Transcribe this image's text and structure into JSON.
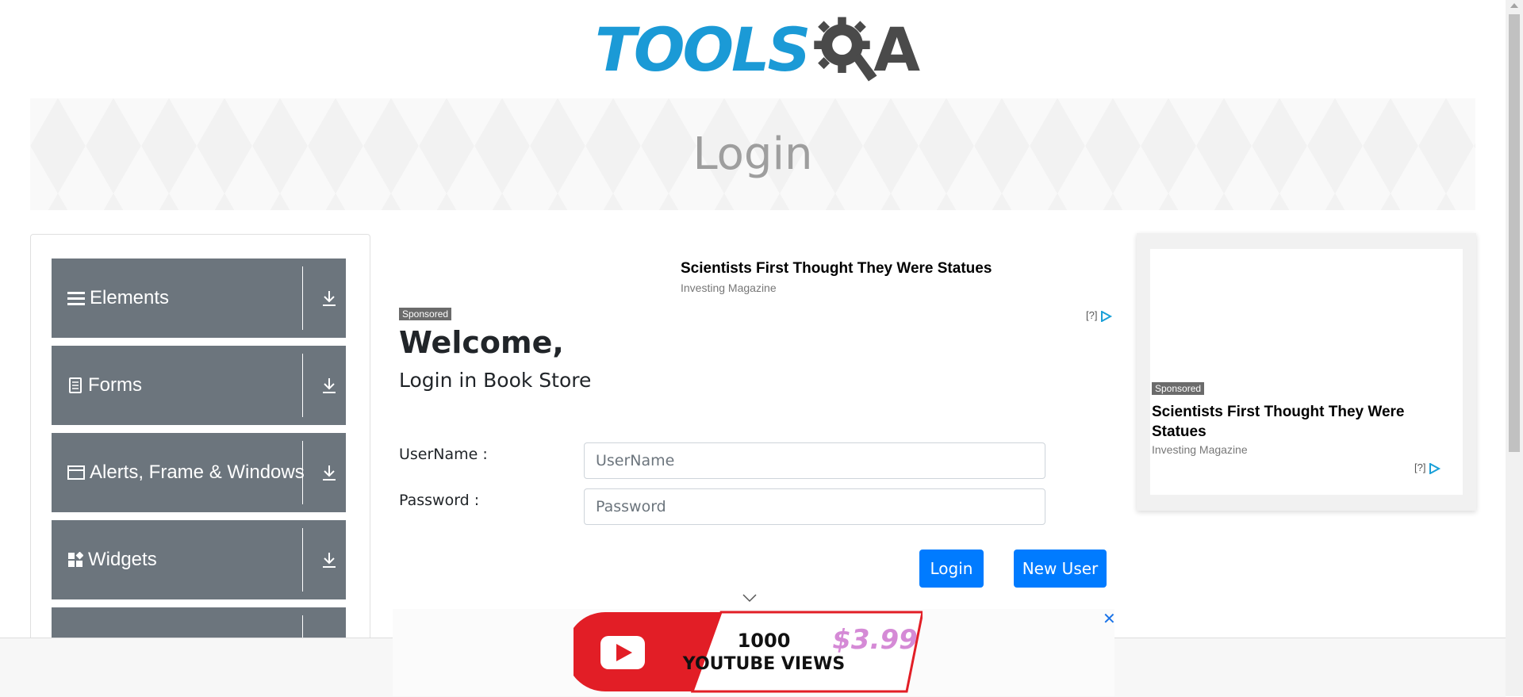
{
  "brand": {
    "logo_text": "TOOLS",
    "logo_suffix": "A"
  },
  "banner": {
    "title": "Login"
  },
  "sidebar": {
    "groups": [
      {
        "label": "Elements",
        "icon": "hamburger-icon"
      },
      {
        "label": "Forms",
        "icon": "document-icon"
      },
      {
        "label": "Alerts, Frame & Windows",
        "icon": "window-icon"
      },
      {
        "label": "Widgets",
        "icon": "widgets-icon"
      },
      {
        "label": "",
        "icon": ""
      }
    ]
  },
  "ad_top": {
    "title": "Scientists First Thought They Were Statues",
    "source": "Investing Magazine",
    "sponsored": "Sponsored",
    "mark": "[?]"
  },
  "login": {
    "welcome": "Welcome,",
    "subtitle": "Login in Book Store",
    "username_label": "UserName :",
    "username_placeholder": "UserName",
    "password_label": "Password :",
    "password_placeholder": "Password",
    "login_button": "Login",
    "new_user_button": "New User"
  },
  "ad_right": {
    "sponsored": "Sponsored",
    "title": "Scientists First Thought They Were Statues",
    "source": "Investing Magazine",
    "mark": "[?]"
  },
  "ad_bottom": {
    "line1": "1000",
    "line2": "YOUTUBE VIEWS",
    "price": "$3.99",
    "close": "✕"
  },
  "colors": {
    "accent": "#007bff",
    "sidebar_bg": "#6c757d",
    "logo_blue": "#1b9ad6"
  }
}
